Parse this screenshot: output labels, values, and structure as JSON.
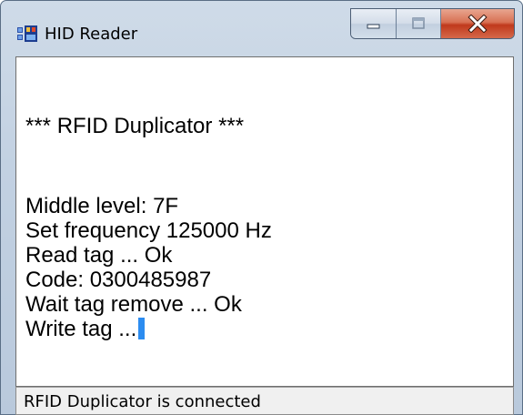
{
  "window": {
    "title": "HID Reader",
    "icon": "app-icon"
  },
  "caption_buttons": {
    "minimize_icon": "minimize-icon",
    "maximize_icon": "maximize-icon",
    "close_icon": "close-icon"
  },
  "console": {
    "lines": [
      "*** RFID Duplicator ***",
      "Middle level: 7F",
      "Set frequency 125000 Hz",
      "Read tag ... Ok",
      "Code: 0300485987",
      "Wait tag remove ... Ok",
      "Write tag ..."
    ]
  },
  "statusbar": {
    "text": "RFID Duplicator is connected"
  },
  "colors": {
    "caret": "#2c8cf0",
    "close_button": "#c8452a"
  }
}
